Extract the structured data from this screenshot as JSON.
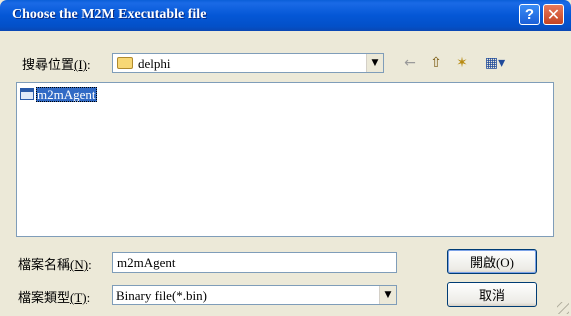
{
  "window": {
    "title": "Choose the M2M Executable file"
  },
  "titlebar_buttons": {
    "help": "?",
    "close": "✕"
  },
  "look_in": {
    "label": "搜尋位置",
    "accesskey": "(I)",
    "value": "delphi"
  },
  "toolbar": {
    "back_icon": "←",
    "up_icon": "⇧",
    "new_folder_icon": "✶",
    "view_menu_icon": "▦▾"
  },
  "files": [
    {
      "name": "m2mAgent",
      "selected": true
    }
  ],
  "filename": {
    "label": "檔案名稱",
    "accesskey": "(N)",
    "value": "m2mAgent"
  },
  "filetype": {
    "label": "檔案類型",
    "accesskey": "(T)",
    "value": "Binary file(*.bin)"
  },
  "buttons": {
    "open": "開啟(O)",
    "cancel": "取消"
  }
}
